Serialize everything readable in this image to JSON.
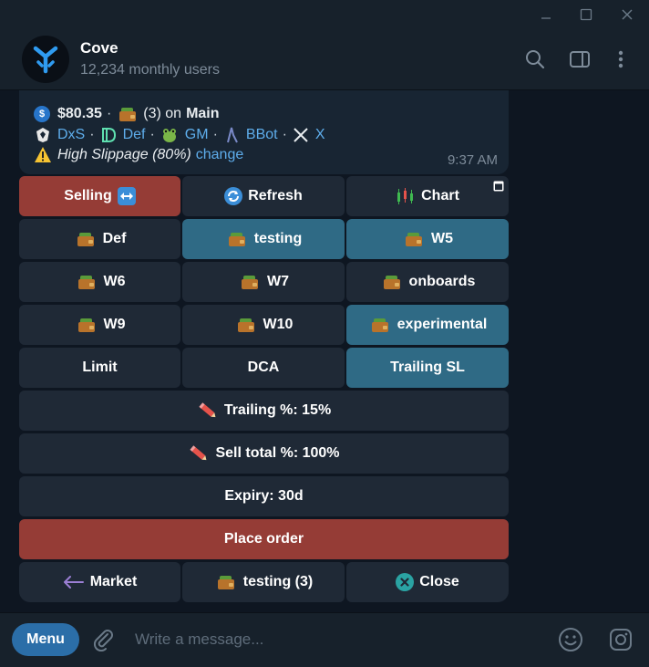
{
  "chat": {
    "title": "Cove",
    "subtitle": "12,234 monthly users"
  },
  "message": {
    "line1": {
      "amount": "$80.35",
      "sep": "·",
      "count_text": "(3) on",
      "wallet_name": "Main"
    },
    "line2": {
      "links": [
        "DxS",
        "Def",
        "GM",
        "BBot",
        "X"
      ],
      "sep": "·"
    },
    "line3": {
      "text": "High Slippage (80%)",
      "action": "change"
    },
    "time": "9:37 AM"
  },
  "keyboard": {
    "rows": [
      [
        {
          "label": "Selling",
          "style": "red"
        },
        {
          "label": "Refresh"
        },
        {
          "label": "Chart"
        }
      ],
      [
        {
          "label": "Def"
        },
        {
          "label": "testing",
          "style": "teal"
        },
        {
          "label": "W5",
          "style": "teal"
        }
      ],
      [
        {
          "label": "W6"
        },
        {
          "label": "W7"
        },
        {
          "label": "onboards"
        }
      ],
      [
        {
          "label": "W9"
        },
        {
          "label": "W10"
        },
        {
          "label": "experimental",
          "style": "teal"
        }
      ],
      [
        {
          "label": "Limit"
        },
        {
          "label": "DCA"
        },
        {
          "label": "Trailing SL",
          "style": "teal"
        }
      ],
      [
        {
          "label": "Trailing %: 15%"
        }
      ],
      [
        {
          "label": "Sell total %: 100%"
        }
      ],
      [
        {
          "label": "Expiry: 30d"
        }
      ],
      [
        {
          "label": "Place order",
          "style": "red"
        }
      ],
      [
        {
          "label": "Market"
        },
        {
          "label": "testing (3)"
        },
        {
          "label": "Close"
        }
      ]
    ]
  },
  "composer": {
    "menu_label": "Menu",
    "placeholder": "Write a message..."
  },
  "colors": {
    "background": "#0e1621",
    "header": "#17212b",
    "button": "#1f2936",
    "button_active": "#2f6a85",
    "button_danger": "#953c36",
    "link": "#5eadeb",
    "menu_button": "#2b6ea8"
  },
  "icons": [
    "minimize-icon",
    "maximize-icon",
    "close-window-icon",
    "search-icon",
    "sidebar-toggle-icon",
    "more-vertical-icon",
    "attach-icon",
    "emoji-icon",
    "sticker-icon",
    "wallet-icon",
    "pencil-icon",
    "refresh-icon",
    "chart-icon",
    "swap-arrows-icon",
    "back-arrow-icon",
    "close-circle-icon",
    "warning-icon",
    "usdc-coin-icon"
  ]
}
